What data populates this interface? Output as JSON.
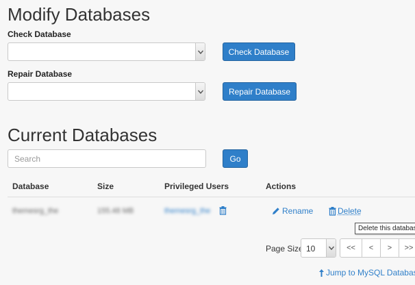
{
  "modify": {
    "title": "Modify Databases",
    "check_label": "Check Database",
    "check_select_value": "",
    "check_button": "Check Database",
    "repair_label": "Repair Database",
    "repair_select_value": "",
    "repair_button": "Repair Database"
  },
  "current": {
    "title": "Current Databases",
    "search_placeholder": "Search",
    "go_button": "Go"
  },
  "table": {
    "headers": {
      "database": "Database",
      "size": "Size",
      "users": "Privileged Users",
      "actions": "Actions"
    },
    "rows": [
      {
        "database": "themesrg_the",
        "size": "155.48 MB",
        "user": "themesrg_the",
        "rename": "Rename",
        "delete": "Delete"
      }
    ]
  },
  "tooltip": "Delete this database",
  "pagination": {
    "label": "Page Size",
    "value": "10",
    "first": "<<",
    "prev": "<",
    "next": ">",
    "last": ">>"
  },
  "jump_link": "Jump to MySQL Databases",
  "icons": {
    "rename": "pencil-icon",
    "delete": "trash-icon",
    "user_delete": "trash-icon",
    "jump": "arrow-up-icon"
  },
  "colors": {
    "primary": "#2f7fc9",
    "background": "#f7f7f7"
  }
}
